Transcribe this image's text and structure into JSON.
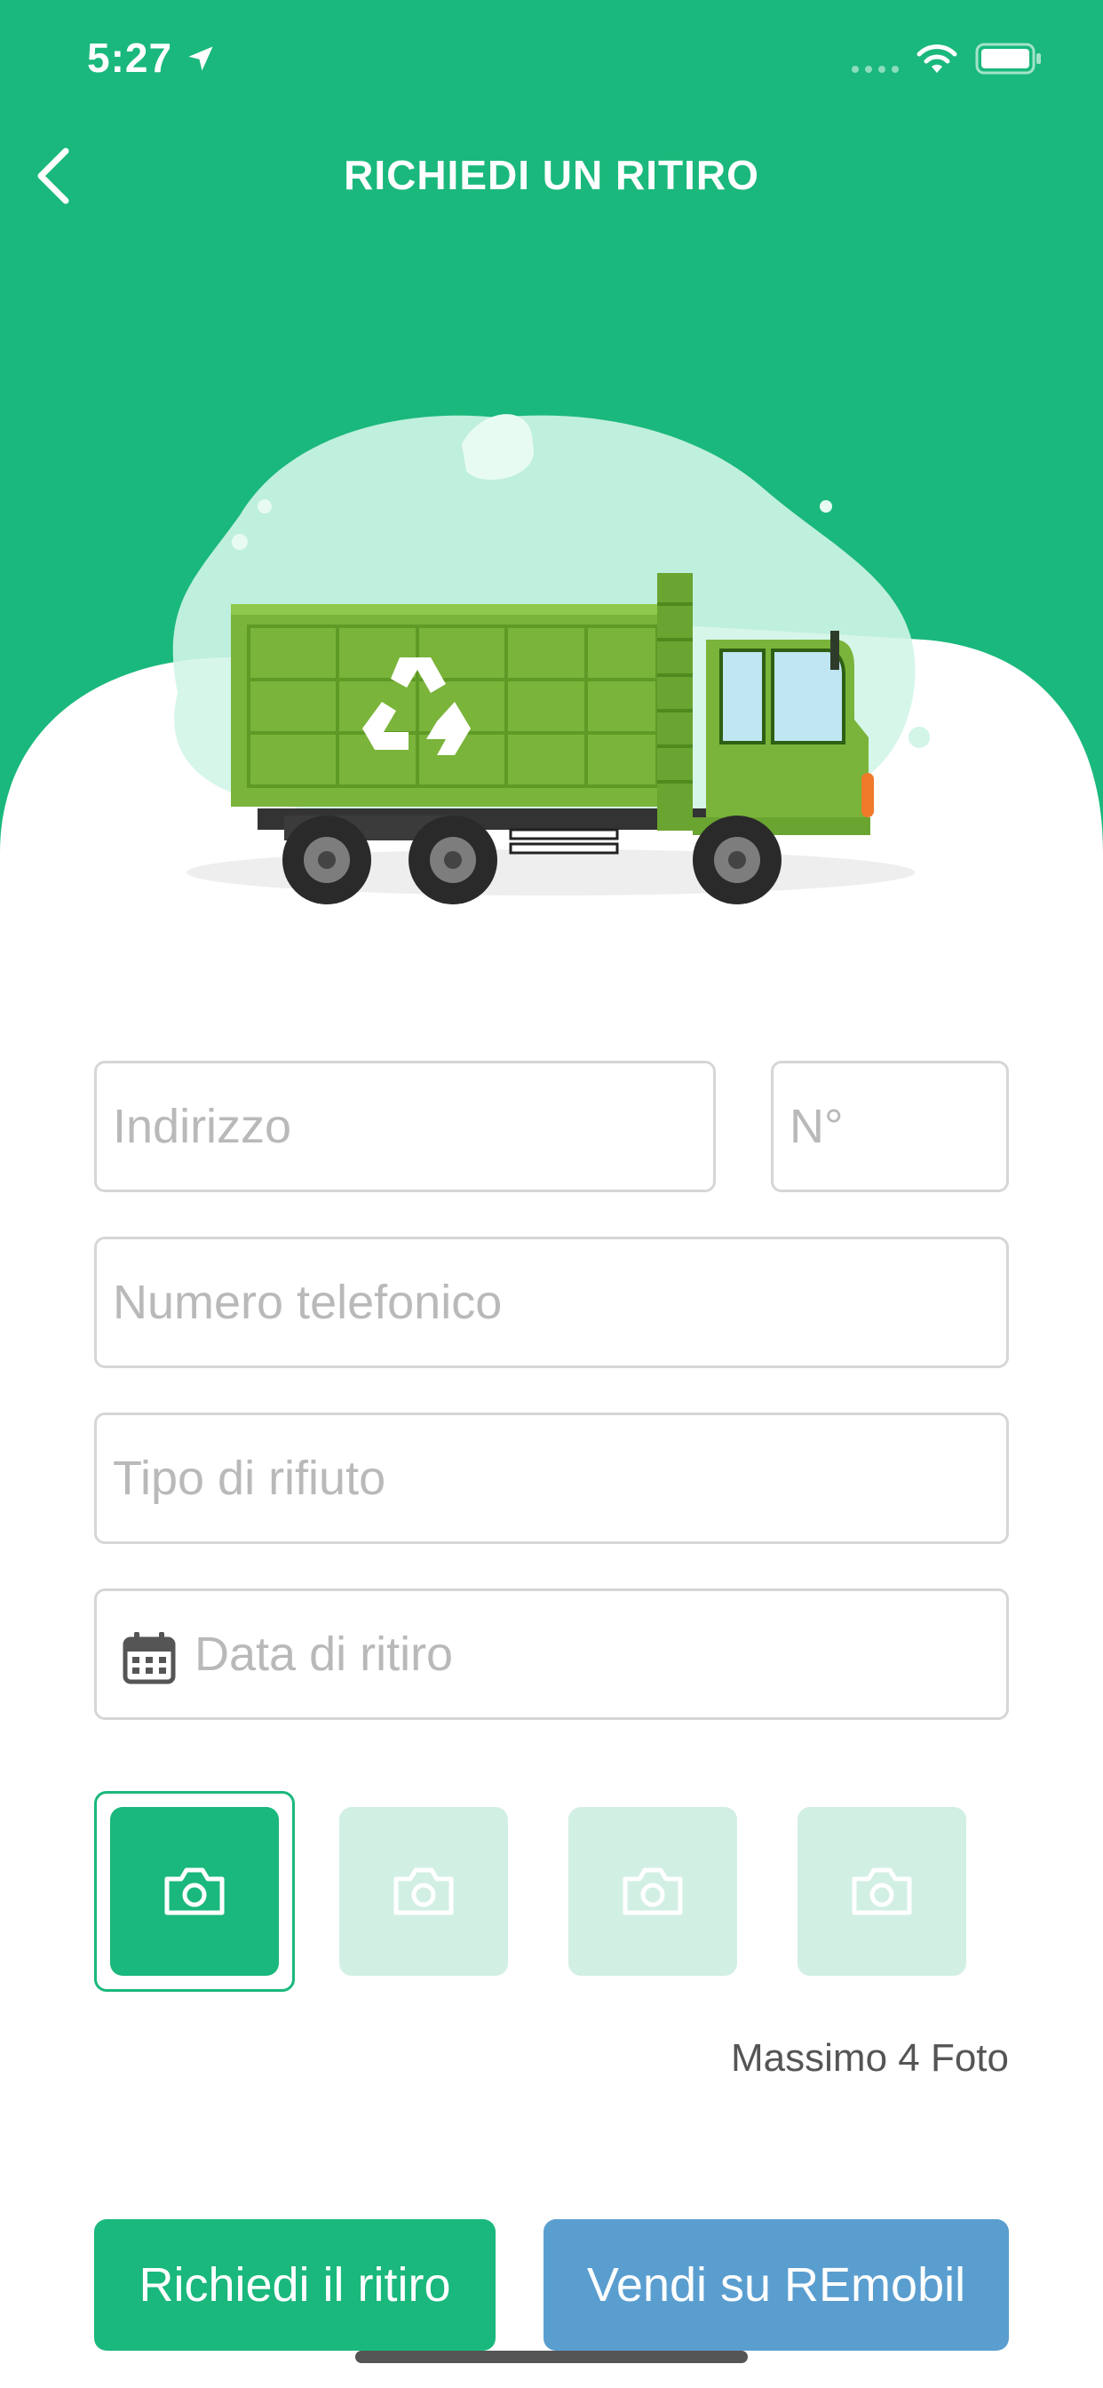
{
  "status_bar": {
    "time": "5:27"
  },
  "nav": {
    "title": "RICHIEDI UN RITIRO"
  },
  "form": {
    "indirizzo_placeholder": "Indirizzo",
    "numero_placeholder": "N°",
    "telefono_placeholder": "Numero telefonico",
    "tipo_placeholder": "Tipo di rifiuto",
    "data_placeholder": "Data di ritiro"
  },
  "photos": {
    "max_label": "Massimo 4 Foto"
  },
  "buttons": {
    "richiedi": "Richiedi il ritiro",
    "vendi": "Vendi su REmobil"
  },
  "colors": {
    "primary": "#1ab87c",
    "secondary": "#5a9ed0",
    "photo_inactive": "#d2efe4",
    "truck_green": "#7ab43a"
  }
}
